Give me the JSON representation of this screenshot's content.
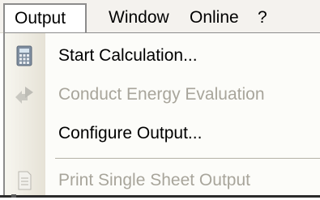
{
  "menubar": {
    "items": [
      {
        "label": "Output",
        "active": true
      },
      {
        "label": "Window"
      },
      {
        "label": "Online"
      },
      {
        "label": "?"
      }
    ]
  },
  "dropdown": {
    "items": [
      {
        "label": "Start Calculation...",
        "enabled": true,
        "icon": "calculator-icon"
      },
      {
        "label": "Conduct Energy Evaluation",
        "enabled": false,
        "icon": "energy-evaluation-icon"
      },
      {
        "label": "Configure Output...",
        "enabled": true
      },
      {
        "label": "Print Single Sheet Output",
        "enabled": false,
        "icon": "document-icon"
      }
    ]
  },
  "colors": {
    "menubar_bg": "#f4f2ee",
    "menu_bg": "#fcfcf9",
    "disabled_text": "#a8a59b",
    "border": "#8c8c8c"
  }
}
